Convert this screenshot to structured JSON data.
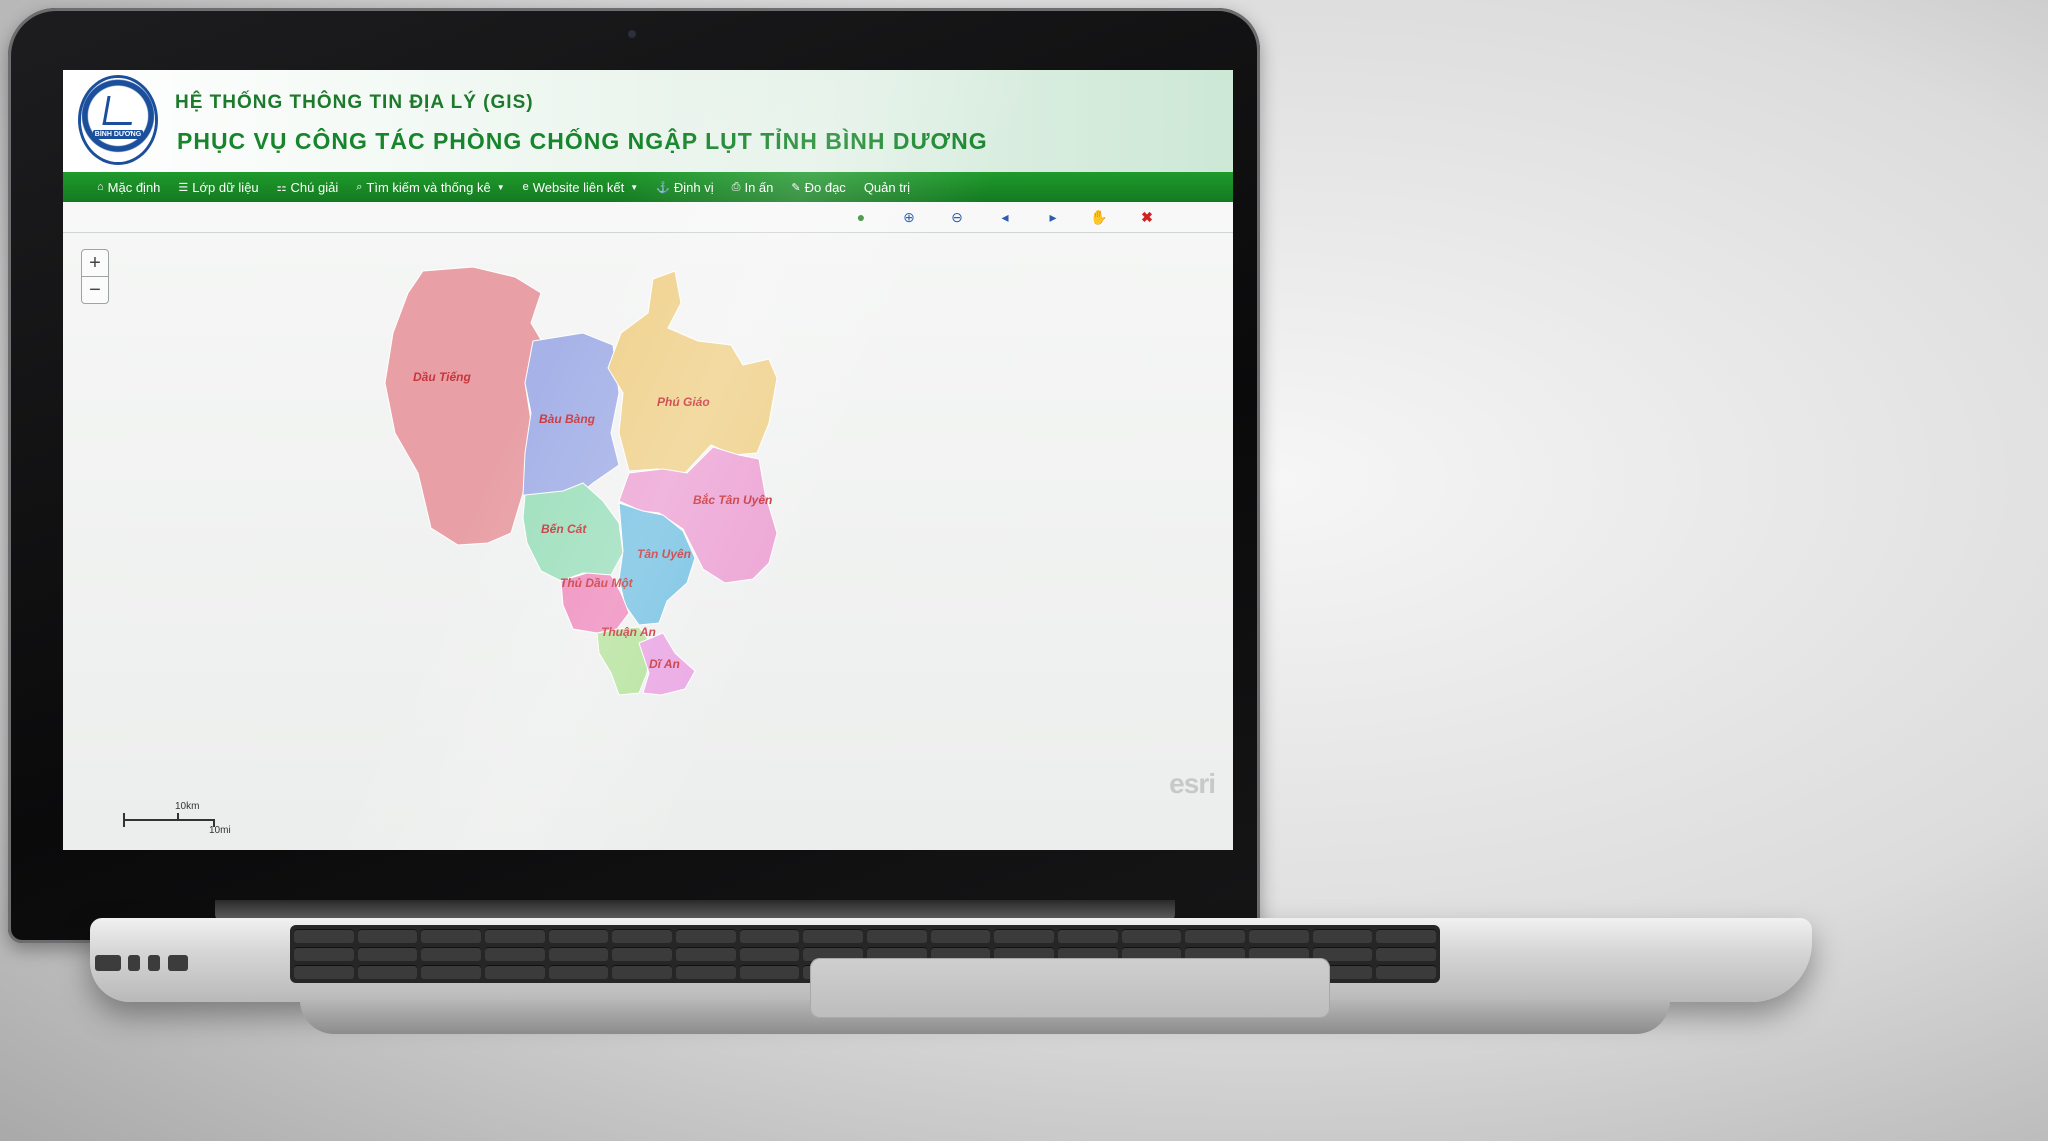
{
  "app": {
    "logo_text": "BÌNH DƯƠNG",
    "title_line1": "HỆ THỐNG THÔNG TIN ĐỊA LÝ (GIS)",
    "title_line2": "PHỤC VỤ CÔNG TÁC PHÒNG CHỐNG NGẬP LỤT TỈNH BÌNH DƯƠNG"
  },
  "menu": [
    {
      "label": "Mặc định",
      "icon": "home-icon"
    },
    {
      "label": "Lớp dữ liệu",
      "icon": "list-icon"
    },
    {
      "label": "Chú giải",
      "icon": "legend-icon"
    },
    {
      "label": "Tìm kiếm và thống kê",
      "icon": "search-icon"
    },
    {
      "label": "Website liên kết",
      "icon": "link-icon"
    },
    {
      "label": "Định vị",
      "icon": "locate-icon"
    },
    {
      "label": "In ấn",
      "icon": "print-icon"
    },
    {
      "label": "Đo đạc",
      "icon": "ruler-icon"
    },
    {
      "label": "Quản trị",
      "icon": ""
    }
  ],
  "toolbar": {
    "tools": [
      "globe-icon",
      "zoom-in-icon",
      "zoom-out-icon",
      "zoom-prev-icon",
      "zoom-next-icon",
      "pan-icon",
      "close-icon"
    ],
    "colors": {
      "globe": "#3a8f3a",
      "zoom": "#2a5db0",
      "pan": "#e0a860",
      "close": "#d42020"
    }
  },
  "map": {
    "zoom_in": "+",
    "zoom_out": "−",
    "districts": [
      {
        "name": "Dầu Tiếng",
        "color": "#e8a0a6"
      },
      {
        "name": "Bàu Bàng",
        "color": "#a6b2e8"
      },
      {
        "name": "Phú Giáo",
        "color": "#f0d28e"
      },
      {
        "name": "Bắc Tân Uyên",
        "color": "#eda6d6"
      },
      {
        "name": "Bến Cát",
        "color": "#9fe0be"
      },
      {
        "name": "Tân Uyên",
        "color": "#7cc4e4"
      },
      {
        "name": "Thủ Dầu Một",
        "color": "#ef8fbf"
      },
      {
        "name": "Thuận An",
        "color": "#b8e4a0"
      },
      {
        "name": "Dĩ An",
        "color": "#eaa8e4"
      }
    ],
    "scale_km": "10km",
    "scale_mi": "10mi",
    "esri": "esri"
  }
}
